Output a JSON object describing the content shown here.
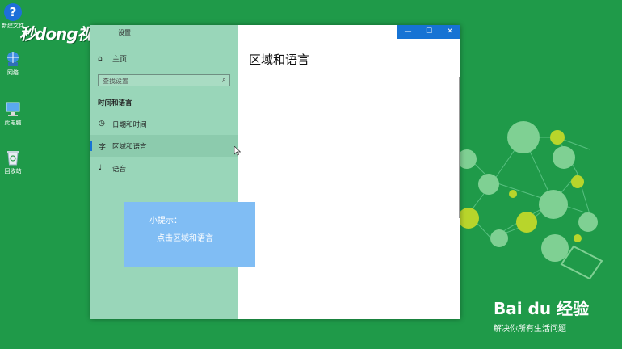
{
  "desktop": {
    "icons": [
      {
        "label": "新建文件",
        "icon": "help-icon"
      },
      {
        "label": "网络",
        "icon": "network-icon"
      },
      {
        "label": "此电脑",
        "icon": "computer-icon"
      },
      {
        "label": "回收站",
        "icon": "recycle-bin-icon"
      }
    ],
    "watermark": "秒dong视频"
  },
  "window": {
    "title": "设置",
    "buttons": {
      "minimize": "—",
      "maximize": "☐",
      "close": "✕"
    },
    "sidebar": {
      "home_label": "主页",
      "search_placeholder": "查找设置",
      "section_title": "时间和语言",
      "items": [
        {
          "label": "日期和时间",
          "icon": "calendar-clock-icon",
          "active": false
        },
        {
          "label": "区域和语言",
          "icon": "region-language-icon",
          "active": true
        },
        {
          "label": "语音",
          "icon": "microphone-icon",
          "active": false
        }
      ]
    },
    "main": {
      "title": "区域和语言"
    }
  },
  "tip": {
    "line1": "小提示：",
    "line2": "点击区域和语言"
  },
  "brand": {
    "name": "Bai du 经验",
    "slogan": "解决你所有生活问题"
  },
  "colors": {
    "desktop": "#1f9a49",
    "sidebar": "#99d6b9",
    "accent": "#1673d4",
    "tip": "#80bdf4"
  }
}
